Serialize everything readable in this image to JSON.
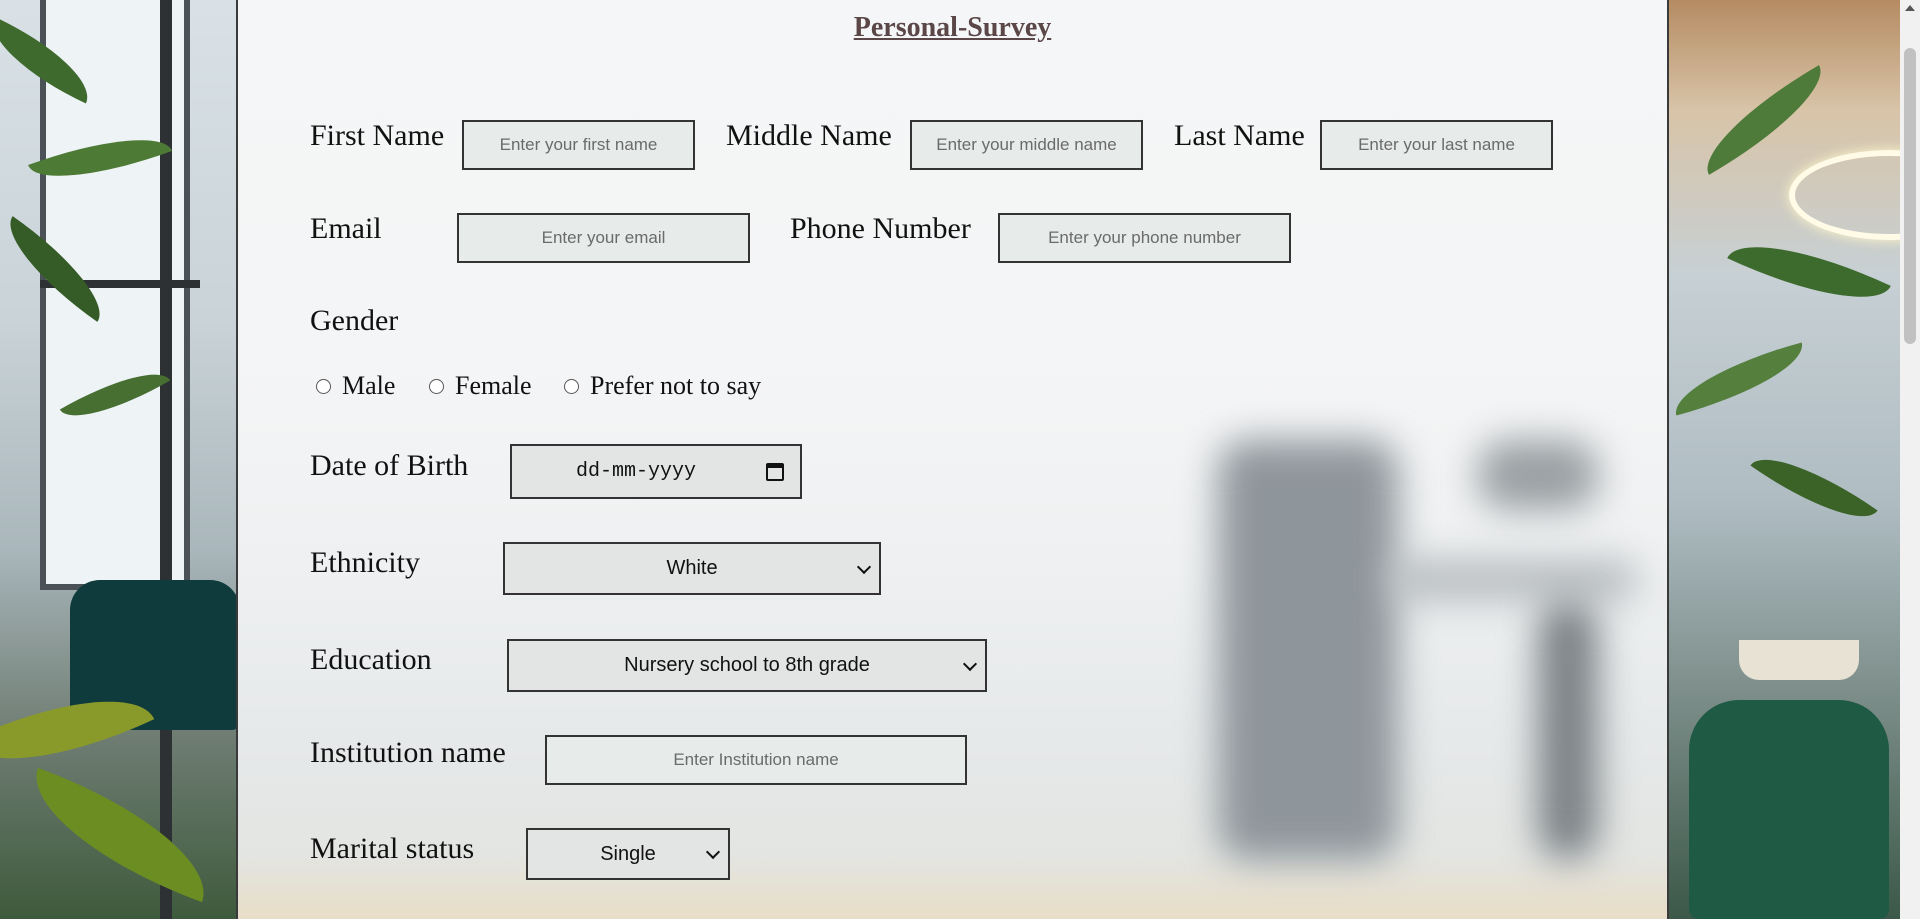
{
  "page": {
    "title": "Personal-Survey"
  },
  "form": {
    "first_name": {
      "label": "First Name",
      "placeholder": "Enter your first name"
    },
    "middle_name": {
      "label": "Middle Name",
      "placeholder": "Enter your middle name"
    },
    "last_name": {
      "label": "Last Name",
      "placeholder": "Enter your last name"
    },
    "email": {
      "label": "Email",
      "placeholder": "Enter your email"
    },
    "phone": {
      "label": "Phone Number",
      "placeholder": "Enter your phone number"
    },
    "gender": {
      "label": "Gender",
      "options": [
        "Male",
        "Female",
        "Prefer not to say"
      ]
    },
    "dob": {
      "label": "Date of Birth",
      "placeholder": "dd-mm-yyyy"
    },
    "ethnicity": {
      "label": "Ethnicity",
      "value": "White"
    },
    "education": {
      "label": "Education",
      "value": "Nursery school to 8th grade"
    },
    "institution": {
      "label": "Institution name",
      "placeholder": "Enter Institution name"
    },
    "marital": {
      "label": "Marital status",
      "value": "Single"
    }
  },
  "icons": {
    "calendar": "calendar-icon",
    "chevron": "chevron-down-icon",
    "scroll_up": "arrow-up-icon"
  }
}
